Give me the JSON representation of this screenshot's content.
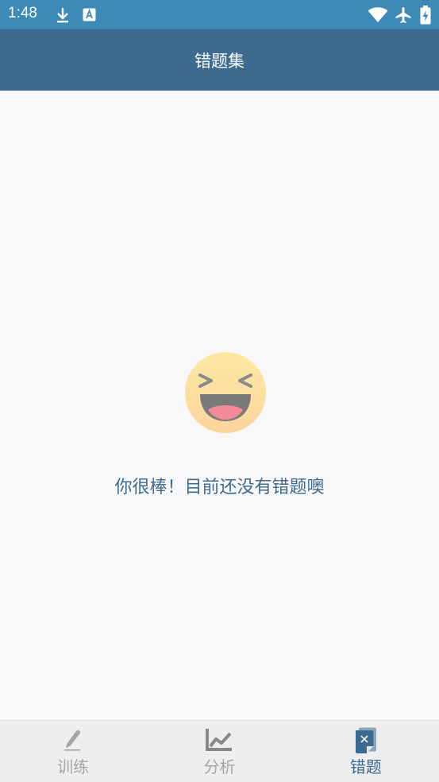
{
  "status_bar": {
    "time": "1:48",
    "icons": [
      "download-icon",
      "keyboard-a-icon",
      "wifi-icon",
      "airplane-icon",
      "battery-charging-icon"
    ]
  },
  "app_bar": {
    "title": "错题集"
  },
  "empty_state": {
    "icon": "laughing-face-icon",
    "message": "你很棒！目前还没有错题噢"
  },
  "bottom_nav": {
    "items": [
      {
        "label": "训练",
        "icon": "pencil-icon",
        "active": false
      },
      {
        "label": "分析",
        "icon": "chart-icon",
        "active": false
      },
      {
        "label": "错题",
        "icon": "wrong-question-icon",
        "active": true
      }
    ]
  },
  "colors": {
    "status_bar": "#3d8ab6",
    "app_bar": "#3d6b90",
    "accent": "#3d6b90",
    "inactive": "#a5a5a5",
    "background": "#f8f8f8"
  }
}
